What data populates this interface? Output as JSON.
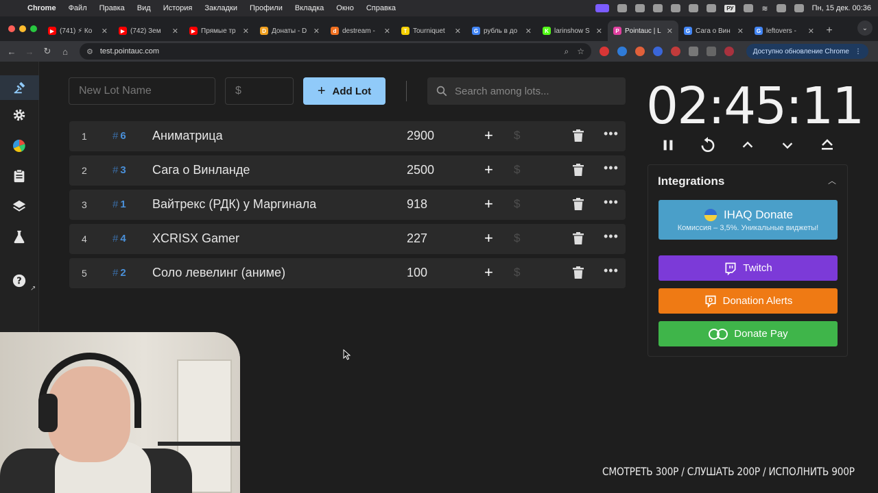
{
  "menubar": {
    "app": "Chrome",
    "items": [
      "Файл",
      "Правка",
      "Вид",
      "История",
      "Закладки",
      "Профили",
      "Вкладка",
      "Окно",
      "Справка"
    ],
    "lang": "РУ",
    "datetime": "Пн, 15 дек.  00:36"
  },
  "tabs": [
    {
      "title": "(741) ⚡ Ко",
      "fav_color": "#ff0000",
      "fav": "▶"
    },
    {
      "title": "(742) Зем",
      "fav_color": "#ff0000",
      "fav": "▶"
    },
    {
      "title": "Прямые тр",
      "fav_color": "#ff0000",
      "fav": "▶"
    },
    {
      "title": "Донаты - D",
      "fav_color": "#f0a020",
      "fav": "D"
    },
    {
      "title": "destream -",
      "fav_color": "#f07020",
      "fav": "d"
    },
    {
      "title": "Tourniquet",
      "fav_color": "#f5d000",
      "fav": "T"
    },
    {
      "title": "рубль в до",
      "fav_color": "#4285f4",
      "fav": "G"
    },
    {
      "title": "larinshow S",
      "fav_color": "#53fc18",
      "fav": "K"
    },
    {
      "title": "Pointauc | L",
      "fav_color": "#e040a0",
      "fav": "P",
      "active": true
    },
    {
      "title": "Сага о Вин",
      "fav_color": "#4285f4",
      "fav": "G"
    },
    {
      "title": "leftovers -",
      "fav_color": "#4285f4",
      "fav": "G"
    }
  ],
  "address": {
    "url": "test.pointauc.com",
    "update_label": "Доступно обновление Chrome"
  },
  "toolbar": {
    "new_lot_placeholder": "New Lot Name",
    "amount_placeholder": "$",
    "add_label": "Add Lot",
    "search_placeholder": "Search among lots..."
  },
  "lots": [
    {
      "index": "1",
      "fast_id": "6",
      "name": "Аниматрица",
      "amount": "2900"
    },
    {
      "index": "2",
      "fast_id": "3",
      "name": "Сага о Винланде",
      "amount": "2500"
    },
    {
      "index": "3",
      "fast_id": "1",
      "name": "Вайтрекс (РДК) у Маргинала",
      "amount": "918"
    },
    {
      "index": "4",
      "fast_id": "4",
      "name": "XCRISX Gamer",
      "amount": "227"
    },
    {
      "index": "5",
      "fast_id": "2",
      "name": "Соло левелинг (аниме)",
      "amount": "100"
    }
  ],
  "lot_symbols": {
    "hash": "#",
    "plus": "+",
    "dollar": "$",
    "more": "•••"
  },
  "timer": {
    "value": "02:45:11"
  },
  "integrations": {
    "title": "Integrations",
    "ihaq_title": "IHAQ Donate",
    "ihaq_sub": "Комиссия – 3,5%. Уникальные виджеты!",
    "twitch": "Twitch",
    "donation_alerts": "Donation Alerts",
    "donate_pay": "Donate Pay"
  },
  "overlay_text": "СМОТРЕТЬ 300Р  /  СЛУШАТЬ 200Р  /  ИСПОЛНИТЬ  900Р",
  "colors": {
    "accent": "#90caf9",
    "twitch": "#7c3ad8",
    "donation_alerts": "#ef7a14",
    "donate_pay": "#3fb54a",
    "ihaq": "#4a9fc9"
  }
}
